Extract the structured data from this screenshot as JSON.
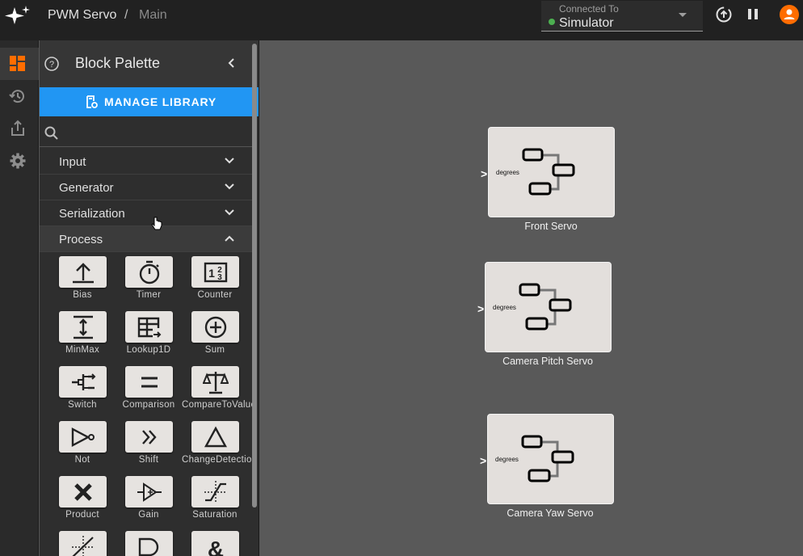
{
  "topbar": {
    "breadcrumb_app": "PWM Servo",
    "breadcrumb_sep": "/",
    "breadcrumb_page": "Main",
    "connection_label": "Connected To",
    "connection_value": "Simulator",
    "connection_status_color": "#4caf50",
    "icons": [
      "sparkle-logo-icon",
      "deploy-icon",
      "pause-icon",
      "user-avatar-icon"
    ]
  },
  "rail": {
    "items": [
      {
        "icon": "dashboard-icon",
        "active": true,
        "color": "#ff6d00"
      },
      {
        "icon": "history-icon",
        "active": false
      },
      {
        "icon": "share-icon",
        "active": false
      },
      {
        "icon": "settings-icon",
        "active": false
      }
    ]
  },
  "palette": {
    "title": "Block Palette",
    "manage_library": "MANAGE LIBRARY",
    "search_placeholder": "",
    "categories": [
      {
        "label": "Input",
        "expanded": false
      },
      {
        "label": "Generator",
        "expanded": false
      },
      {
        "label": "Serialization",
        "expanded": false
      },
      {
        "label": "Process",
        "expanded": true
      }
    ],
    "blocks": [
      {
        "label": "Bias",
        "icon": "bias-icon"
      },
      {
        "label": "Timer",
        "icon": "timer-icon"
      },
      {
        "label": "Counter",
        "icon": "counter-icon"
      },
      {
        "label": "MinMax",
        "icon": "minmax-icon"
      },
      {
        "label": "Lookup1D",
        "icon": "lookup-table-icon"
      },
      {
        "label": "Sum",
        "icon": "sum-icon"
      },
      {
        "label": "Switch",
        "icon": "switch-icon"
      },
      {
        "label": "Comparison",
        "icon": "comparison-icon"
      },
      {
        "label": "CompareToValue",
        "icon": "scale-icon"
      },
      {
        "label": "Not",
        "icon": "not-gate-icon"
      },
      {
        "label": "Shift",
        "icon": "shift-icon"
      },
      {
        "label": "ChangeDetection",
        "icon": "triangle-icon"
      },
      {
        "label": "Product",
        "icon": "product-icon"
      },
      {
        "label": "Gain",
        "icon": "gain-icon"
      },
      {
        "label": "Saturation",
        "icon": "saturation-icon"
      },
      {
        "label": "",
        "icon": "deadzone-icon"
      },
      {
        "label": "",
        "icon": "and-gate-icon"
      },
      {
        "label": "",
        "icon": "ampersand-icon"
      }
    ]
  },
  "canvas": {
    "nodes": [
      {
        "name": "Front Servo",
        "port": "degrees"
      },
      {
        "name": "Camera Pitch Servo",
        "port": "degrees"
      },
      {
        "name": "Camera Yaw Servo",
        "port": "degrees"
      }
    ]
  }
}
